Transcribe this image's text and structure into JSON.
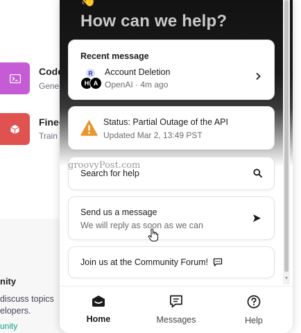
{
  "background": {
    "apps": [
      {
        "title": "Code",
        "subtitle": "Gene",
        "icon": "terminal-icon",
        "color": "#c55bd5"
      },
      {
        "title": "Fine-",
        "subtitle": "Train",
        "icon": "cube-icon",
        "color": "#e0524f"
      }
    ],
    "community": {
      "title": "nity",
      "desc_line1": "discuss topics",
      "desc_line2": "elopers.",
      "link": "unity"
    }
  },
  "widget": {
    "wave_emoji": "👋",
    "headline": "How can we help?",
    "recent": {
      "label": "Recent message",
      "avatars": [
        "R",
        "H",
        "A"
      ],
      "title": "Account Deletion",
      "meta": "OpenAI · 4m ago"
    },
    "status": {
      "title": "Status: Partial Outage of the API",
      "meta": "Updated Mar 2, 13:49 PST",
      "icon_color": "#e8962e"
    },
    "search": {
      "label": "Search for help"
    },
    "send": {
      "title": "Send us a message",
      "subtitle": "We will reply as soon as we can"
    },
    "forum": {
      "label": "Join us at the Community Forum!"
    },
    "nav": [
      {
        "label": "Home",
        "icon": "home-icon",
        "active": true
      },
      {
        "label": "Messages",
        "icon": "messages-icon",
        "active": false
      },
      {
        "label": "Help",
        "icon": "help-icon",
        "active": false
      }
    ]
  },
  "watermark": "groovyPost.com"
}
